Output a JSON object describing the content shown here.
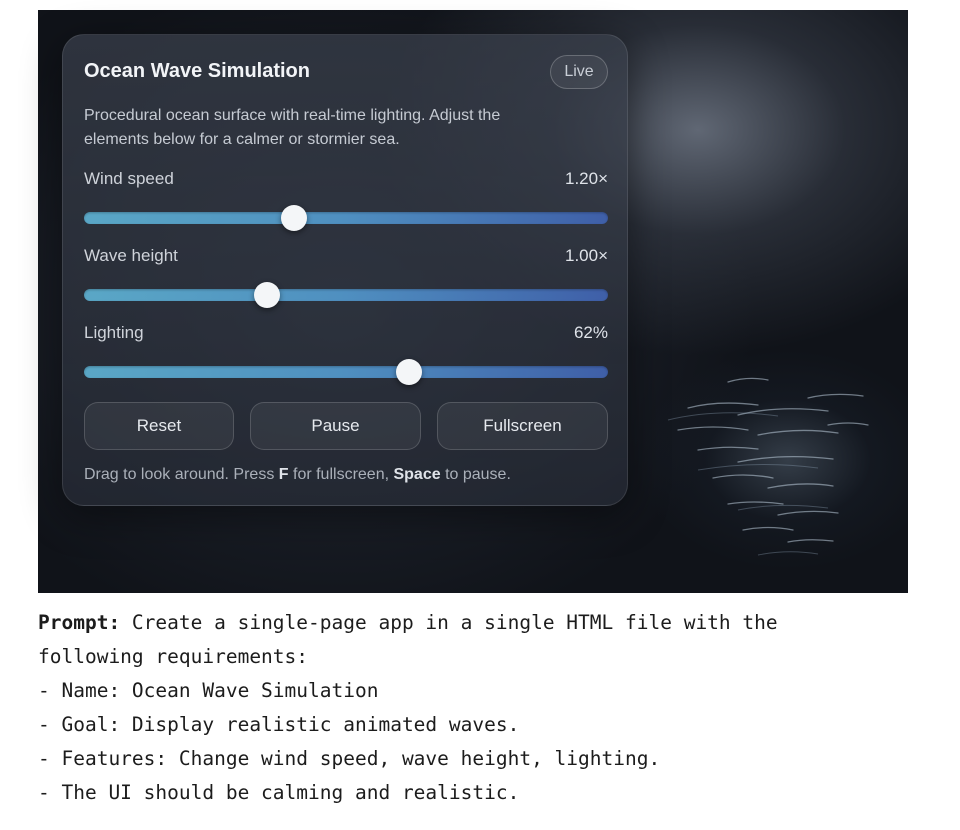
{
  "app": {
    "title": "Ocean Wave Simulation",
    "status_badge": "Live",
    "description": "Procedural ocean surface with real-time lighting. Adjust the elements below for a calmer or stormier sea."
  },
  "controls": {
    "wind_speed": {
      "label": "Wind speed",
      "value_text": "1.20×",
      "level": 0.4
    },
    "wave_height": {
      "label": "Wave height",
      "value_text": "1.00×",
      "level": 0.35
    },
    "lighting": {
      "label": "Lighting",
      "value_text": "62%",
      "level": 0.62
    }
  },
  "buttons": {
    "reset": "Reset",
    "pause": "Pause",
    "fullscreen": "Fullscreen"
  },
  "hint": {
    "part1": "Drag to look around. Press ",
    "key1": "F",
    "part2": " for fullscreen, ",
    "key2": "Space",
    "part3": " to pause."
  },
  "prompt": {
    "label": "Prompt:",
    "line1": " Create a single-page app in a single HTML file with the",
    "line2": "following requirements:",
    "line3": "- Name: Ocean Wave Simulation",
    "line4": "- Goal: Display realistic animated waves.",
    "line5": "- Features: Change wind speed, wave height, lighting.",
    "line6": "- The UI should be calming and realistic."
  },
  "colors": {
    "slider_start": "#5aa7c6",
    "slider_end": "#3f5fa8",
    "panel_text": "#f2f4f7"
  }
}
